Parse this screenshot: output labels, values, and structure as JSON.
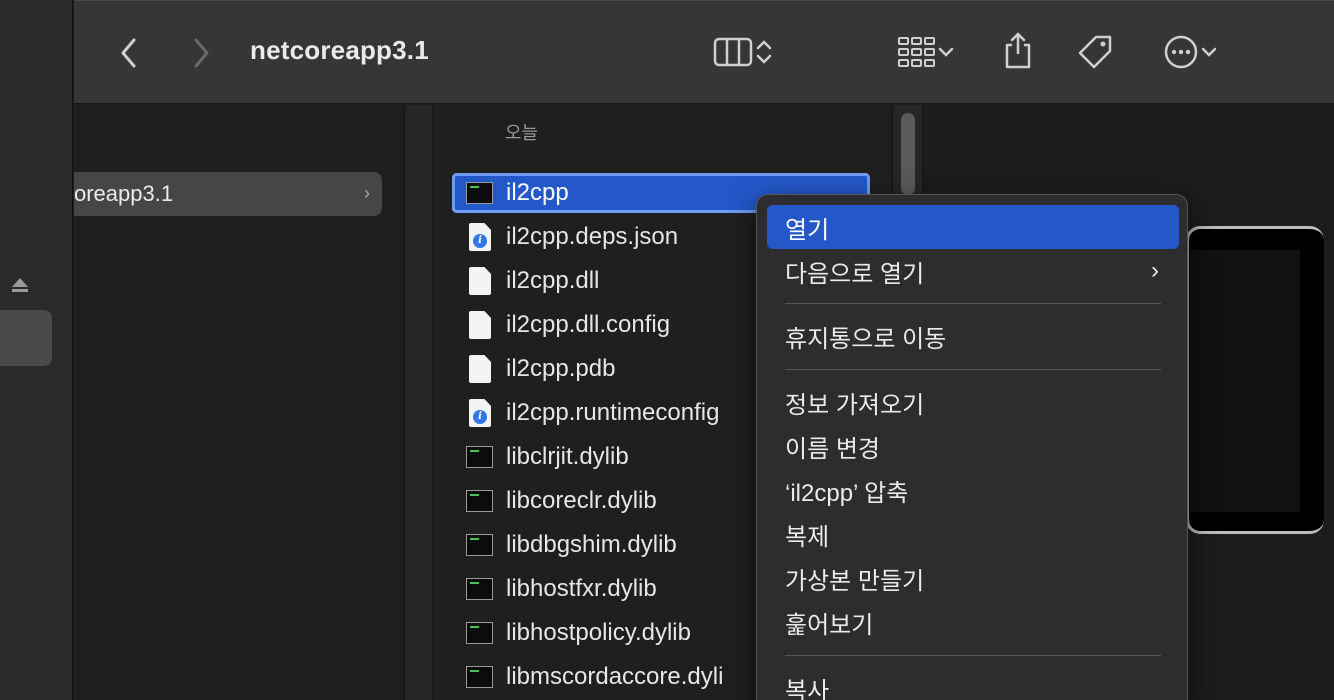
{
  "toolbar": {
    "title": "netcoreapp3.1",
    "back_icon": "chevron-left-icon",
    "forward_icon": "chevron-right-icon",
    "view_icon": "columns-view-icon",
    "group_icon": "grid-group-icon",
    "share_icon": "share-icon",
    "tag_icon": "tag-icon",
    "more_icon": "ellipsis-circle-icon"
  },
  "column1": {
    "folder_label": "oreapp3.1"
  },
  "column2": {
    "section_header": "오늘",
    "files": [
      {
        "name": "il2cpp",
        "type": "exec"
      },
      {
        "name": "il2cpp.deps.json",
        "type": "json"
      },
      {
        "name": "il2cpp.dll",
        "type": "doc"
      },
      {
        "name": "il2cpp.dll.config",
        "type": "doc"
      },
      {
        "name": "il2cpp.pdb",
        "type": "doc"
      },
      {
        "name": "il2cpp.runtimeconfig",
        "type": "json"
      },
      {
        "name": "libclrjit.dylib",
        "type": "exec"
      },
      {
        "name": "libcoreclr.dylib",
        "type": "exec"
      },
      {
        "name": "libdbgshim.dylib",
        "type": "exec"
      },
      {
        "name": "libhostfxr.dylib",
        "type": "exec"
      },
      {
        "name": "libhostpolicy.dylib",
        "type": "exec"
      },
      {
        "name": "libmscordaccore.dyli",
        "type": "exec"
      }
    ]
  },
  "context_menu": {
    "items": [
      {
        "label": "열기"
      },
      {
        "label": "다음으로 열기"
      },
      {
        "label": "휴지통으로 이동"
      },
      {
        "label": "정보 가져오기"
      },
      {
        "label": "이름 변경"
      },
      {
        "label": "‘il2cpp’ 압축"
      },
      {
        "label": "복제"
      },
      {
        "label": "가상본 만들기"
      },
      {
        "label": "훑어보기"
      },
      {
        "label": "복사"
      }
    ],
    "highlight_color": "#2458c9"
  }
}
